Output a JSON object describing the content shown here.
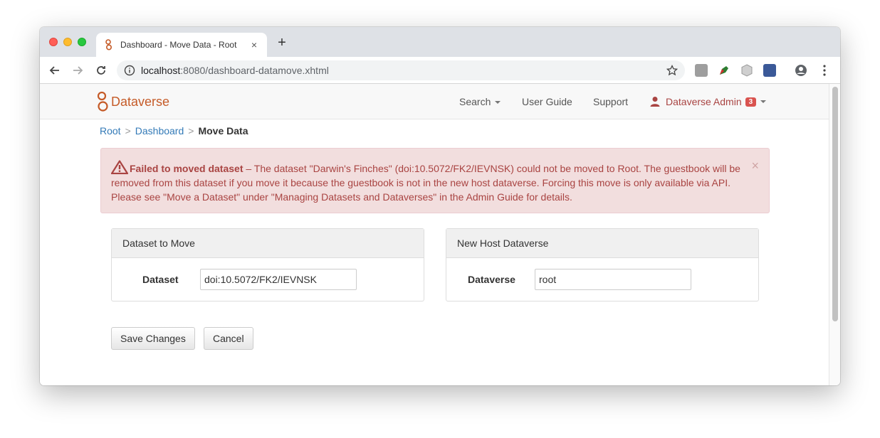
{
  "browser": {
    "tab_title": "Dashboard - Move Data - Root",
    "tab_close": "×",
    "new_tab": "+",
    "url_host": "localhost",
    "url_rest": ":8080/dashboard-datamove.xhtml"
  },
  "navbar": {
    "brand": "Dataverse",
    "search": "Search",
    "user_guide": "User Guide",
    "support": "Support",
    "user": "Dataverse Admin",
    "badge": "3"
  },
  "breadcrumb": {
    "root": "Root",
    "sep1": ">",
    "dashboard": "Dashboard",
    "sep2": ">",
    "current": "Move Data"
  },
  "alert": {
    "title": "Failed to moved dataset",
    "message": " – The dataset \"Darwin's Finches\" (doi:10.5072/FK2/IEVNSK) could not be moved to Root. The guestbook will be removed from this dataset if you move it because the guestbook is not in the new host dataverse. Forcing this move is only available via API. Please see \"Move a Dataset\" under \"Managing Datasets and Dataverses\" in the Admin Guide for details.",
    "close": "×"
  },
  "dataset_panel": {
    "heading": "Dataset to Move",
    "label": "Dataset",
    "value": "doi:10.5072/FK2/IEVNSK"
  },
  "dataverse_panel": {
    "heading": "New Host Dataverse",
    "label": "Dataverse",
    "value": "root"
  },
  "buttons": {
    "save": "Save Changes",
    "cancel": "Cancel"
  },
  "colors": {
    "brand": "#c55b28",
    "link": "#337ab7",
    "alert_text": "#a94442",
    "alert_bg": "#f2dede"
  }
}
